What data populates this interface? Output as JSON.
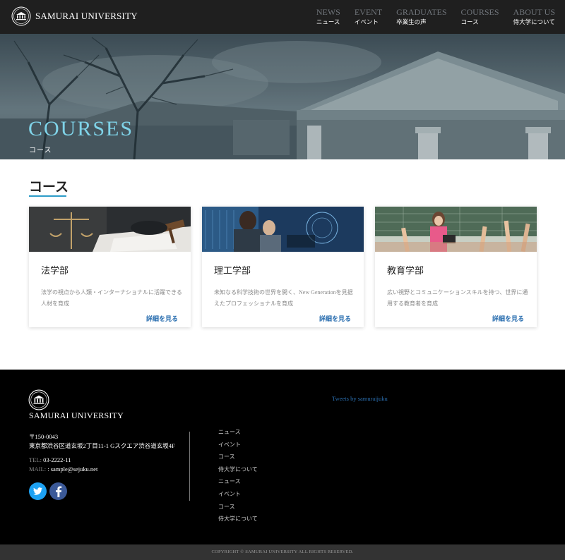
{
  "header": {
    "brand": "SAMURAI UNIVERSITY",
    "nav": [
      {
        "en": "NEWS",
        "ja": "ニュース"
      },
      {
        "en": "EVENT",
        "ja": "イベント"
      },
      {
        "en": "GRADUATES",
        "ja": "卒業生の声"
      },
      {
        "en": "COURSES",
        "ja": "コース"
      },
      {
        "en": "ABOUT US",
        "ja": "侍大学について"
      }
    ]
  },
  "hero": {
    "title": "COURSES",
    "subtitle": "コース"
  },
  "section": {
    "title": "コース"
  },
  "courses": [
    {
      "title": "法学部",
      "desc": "法学の視点から人類・インターナショナルに活躍できる人材を育成",
      "link": "詳細を見る"
    },
    {
      "title": "理工学部",
      "desc": "未知なる科学技術の世界を開く、New Generationを見据えたプロフェッショナルを育成",
      "link": "詳細を見る"
    },
    {
      "title": "教育学部",
      "desc": "広い視野とコミュニケーションスキルを持つ、世界に通用する教育者を育成",
      "link": "詳細を見る"
    }
  ],
  "footer": {
    "brand": "SAMURAI UNIVERSITY",
    "zip": "〒150-0043",
    "address": "東京都渋谷区道玄坂2丁目11-1 Gスクエア渋谷道玄坂4F",
    "tel_label": "TEL:",
    "tel": "03-2222-11",
    "mail_label": "MAIL:",
    "mail": ": sample@sejuku.net",
    "links": [
      "ニュース",
      "イベント",
      "コース",
      "侍大学について",
      "ニュース",
      "イベント",
      "コース",
      "侍大学について"
    ],
    "tweets": "Tweets by samuraijuku"
  },
  "copyright": "COPYRIGHT © SAMURAI UNIVERSITY ALL RIGHTS RESERVED.",
  "colors": {
    "accent": "#2d9cc8",
    "hero_title": "#7fd3e8",
    "link": "#2b6fb0",
    "twitter": "#1da1f2",
    "facebook": "#3b5998"
  },
  "icons": [
    "university-logo-icon",
    "twitter-icon",
    "facebook-icon"
  ]
}
